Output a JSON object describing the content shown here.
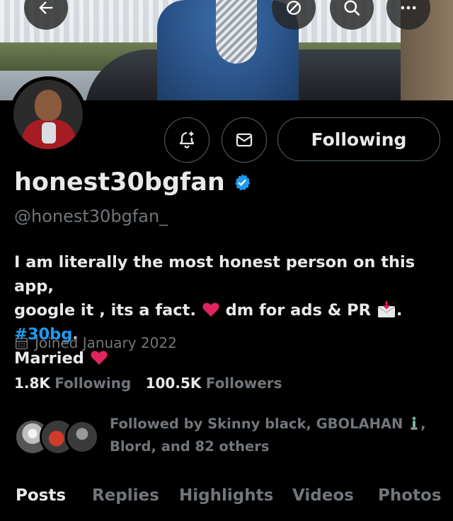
{
  "header": {
    "back_icon": "arrow-left-icon",
    "mute_icon": "mute-slash-icon",
    "search_icon": "search-icon",
    "more_icon": "more-horizontal-icon"
  },
  "actions": {
    "notify_icon": "bell-plus-icon",
    "message_icon": "envelope-icon",
    "follow_label": "Following"
  },
  "profile": {
    "name": "honest30bgfan",
    "handle": "@honest30bgfan_",
    "verified": true,
    "bio_line1": "I am literally the most honest person on this app,",
    "bio_line2a": "google it , its a fact.",
    "bio_line2b": "dm for ads & PR",
    "bio_line2c": ".",
    "bio_hashtag": "#30bg",
    "bio_line2d": ".",
    "bio_line3": "Married",
    "joined": "Joined January 2022"
  },
  "stats": {
    "following_count": "1.8K",
    "following_label": "Following",
    "followers_count": "100.5K",
    "followers_label": "Followers"
  },
  "followed_by": {
    "line1": "Followed by Skinny black, GBOLAHAN",
    "line1_suffix": ",",
    "line2": "Blord, and 82 others"
  },
  "tabs": [
    "Posts",
    "Replies",
    "Highlights",
    "Videos",
    "Photos"
  ],
  "colors": {
    "accent": "#1d9bf0",
    "heart": "#e0245e",
    "muted": "#71767b",
    "text": "#e7e9ea",
    "background": "#000000"
  }
}
